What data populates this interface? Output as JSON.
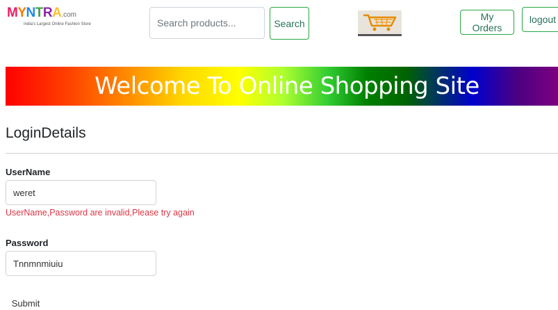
{
  "header": {
    "logo": {
      "letters": [
        "M",
        "Y",
        "N",
        "T",
        "R",
        "A"
      ],
      "domain": ".com",
      "tagline": "India's Largest Online Fashion Store"
    },
    "search": {
      "placeholder": "Search products...",
      "value": ""
    },
    "search_button": "Search",
    "cart_icon": "shopping-cart-icon",
    "my_orders": "My Orders",
    "logout": "logout"
  },
  "banner": {
    "text": "Welcome To Online Shopping Site"
  },
  "login": {
    "title": "LoginDetails",
    "username_label": "UserName",
    "username_value": "weret",
    "error": "UserName,Password are invalid,Please try again",
    "password_label": "Password",
    "password_value": "Tnnmnmiuiu",
    "submit": "Submit"
  },
  "colors": {
    "accent_green": "#28a745",
    "error_red": "#dc3545"
  }
}
